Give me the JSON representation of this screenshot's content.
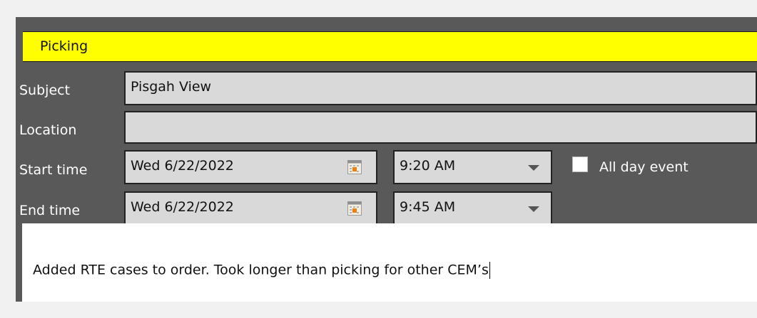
{
  "category": {
    "label": "Picking",
    "color": "#ffff00"
  },
  "form": {
    "subject": {
      "label": "Subject",
      "value": "Pisgah View"
    },
    "location": {
      "label": "Location",
      "value": ""
    },
    "start": {
      "label": "Start time",
      "date": "Wed 6/22/2022",
      "time": "9:20 AM"
    },
    "end": {
      "label": "End time",
      "date": "Wed 6/22/2022",
      "time": "9:45 AM"
    },
    "all_day": {
      "label": "All day event",
      "checked": false
    }
  },
  "notes": {
    "text": "Added RTE cases to order. Took longer than picking for other CEM’s"
  },
  "icons": {
    "date_picker": "calendar-icon",
    "time_dropdown": "chevron-down-icon"
  }
}
